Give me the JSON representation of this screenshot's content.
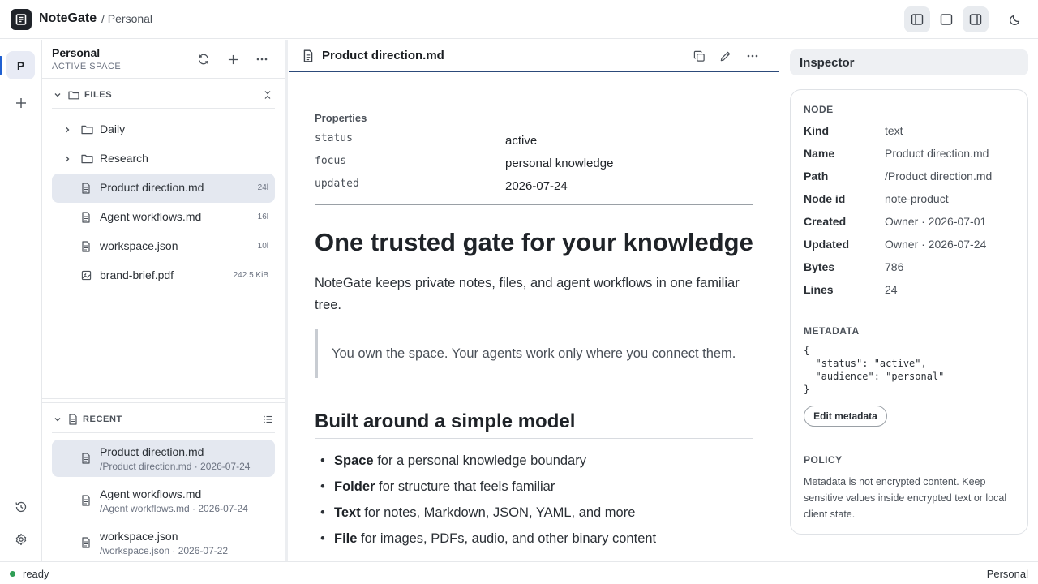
{
  "app": {
    "name": "NoteGate",
    "breadcrumb": "/ Personal"
  },
  "rail": {
    "space_initial": "P"
  },
  "sidebar": {
    "space_title": "Personal",
    "space_subtitle": "ACTIVE SPACE",
    "files_label": "FILES",
    "files": [
      {
        "name": "Daily",
        "type": "folder",
        "meta": ""
      },
      {
        "name": "Research",
        "type": "folder",
        "meta": ""
      },
      {
        "name": "Product direction.md",
        "type": "text",
        "meta": "24l",
        "selected": true
      },
      {
        "name": "Agent workflows.md",
        "type": "text",
        "meta": "16l"
      },
      {
        "name": "workspace.json",
        "type": "text",
        "meta": "10l"
      },
      {
        "name": "brand-brief.pdf",
        "type": "image",
        "meta": "242.5 KiB"
      }
    ],
    "recent_label": "RECENT",
    "recent": [
      {
        "title": "Product direction.md",
        "sub": "/Product direction.md · 2026-07-24",
        "selected": true
      },
      {
        "title": "Agent workflows.md",
        "sub": "/Agent workflows.md · 2026-07-24"
      },
      {
        "title": "workspace.json",
        "sub": "/workspace.json · 2026-07-22"
      }
    ]
  },
  "editor": {
    "title": "Product direction.md",
    "properties_label": "Properties",
    "properties": [
      {
        "key": "status",
        "value": "active"
      },
      {
        "key": "focus",
        "value": "personal knowledge"
      },
      {
        "key": "updated",
        "value": "2026-07-24"
      }
    ],
    "heading": "One trusted gate for your knowledge",
    "paragraph": "NoteGate keeps private notes, files, and agent workflows in one familiar tree.",
    "quote": "You own the space. Your agents work only where you connect them.",
    "subheading": "Built around a simple model",
    "bullets": [
      {
        "strong": "Space",
        "rest": " for a personal knowledge boundary"
      },
      {
        "strong": "Folder",
        "rest": " for structure that feels familiar"
      },
      {
        "strong": "Text",
        "rest": " for notes, Markdown, JSON, YAML, and more"
      },
      {
        "strong": "File",
        "rest": " for images, PDFs, audio, and other binary content"
      }
    ]
  },
  "inspector": {
    "title": "Inspector",
    "node_label": "NODE",
    "node": [
      {
        "key": "Kind",
        "value": "text"
      },
      {
        "key": "Name",
        "value": "Product direction.md"
      },
      {
        "key": "Path",
        "value": "/Product direction.md"
      },
      {
        "key": "Node id",
        "value": "note-product"
      },
      {
        "key": "Created",
        "value": "Owner · 2026-07-01"
      },
      {
        "key": "Updated",
        "value": "Owner · 2026-07-24"
      },
      {
        "key": "Bytes",
        "value": "786"
      },
      {
        "key": "Lines",
        "value": "24"
      }
    ],
    "metadata_label": "METADATA",
    "metadata_json": "{\n  \"status\": \"active\",\n  \"audience\": \"personal\"\n}",
    "edit_metadata_label": "Edit metadata",
    "policy_label": "POLICY",
    "policy_text": "Metadata is not encrypted content. Keep sensitive values inside encrypted text or local client state."
  },
  "status": {
    "text": "ready",
    "right": "Personal",
    "color": "#2f9e55"
  }
}
